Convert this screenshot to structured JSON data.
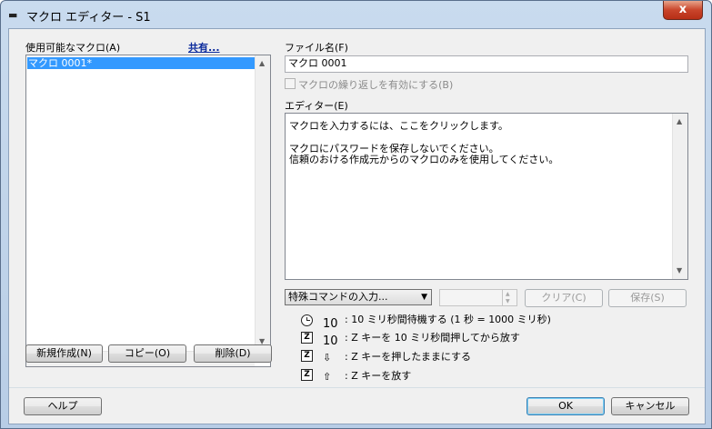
{
  "window": {
    "title": "マクロ エディター - S1",
    "close": "x"
  },
  "left": {
    "list_label": "使用可能なマクロ(A)",
    "share_link": "共有...",
    "macros": [
      "マクロ 0001*"
    ],
    "buttons": {
      "new": "新規作成(N)",
      "copy": "コピー(O)",
      "delete": "削除(D)"
    }
  },
  "right": {
    "filename_label": "ファイル名(F)",
    "filename_value": "マクロ 0001",
    "repeat_checkbox": "マクロの繰り返しを有効にする(B)",
    "editor_label": "エディター(E)",
    "editor_lines": [
      "マクロを入力するには、ここをクリックします。",
      "マクロにパスワードを保存しないでください。",
      "信頼のおける作成元からのマクロのみを使用してください。"
    ],
    "special_command": "特殊コマンドの入力...",
    "clear_button": "クリア(C)",
    "save_button": "保存(S)"
  },
  "legend": [
    {
      "icon": "clock-icon",
      "value": "10",
      "text": ": 10 ミリ秒間待機する (1 秒 = 1000 ミリ秒)"
    },
    {
      "icon": "z-key-icon",
      "key": "Z",
      "value": "10",
      "text": ": Z キーを 10 ミリ秒間押してから放す"
    },
    {
      "icon": "z-key-icon",
      "key": "Z",
      "value": "⇩",
      "text": ": Z キーを押したままにする"
    },
    {
      "icon": "z-key-icon",
      "key": "Z",
      "value": "⇧",
      "text": ": Z キーを放す"
    }
  ],
  "footer": {
    "help": "ヘルプ",
    "ok": "OK",
    "cancel": "キャンセル"
  }
}
